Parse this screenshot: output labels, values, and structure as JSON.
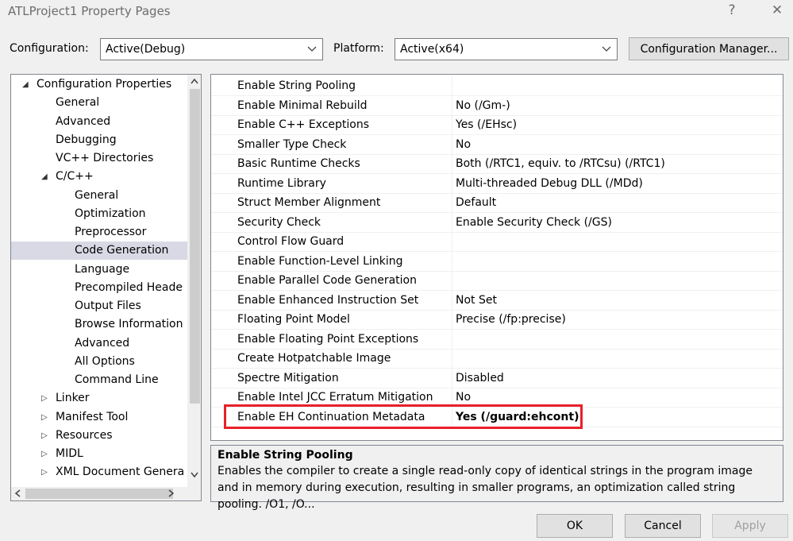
{
  "window": {
    "title": "ATLProject1 Property Pages",
    "help_glyph": "?",
    "close_glyph": "✕"
  },
  "toolbar": {
    "configuration_label": "Configuration:",
    "configuration_value": "Active(Debug)",
    "platform_label": "Platform:",
    "platform_value": "Active(x64)",
    "config_manager_label": "Configuration Manager..."
  },
  "tree": {
    "items": [
      {
        "label": "Configuration Properties",
        "expander": "◢"
      },
      {
        "label": "General"
      },
      {
        "label": "Advanced"
      },
      {
        "label": "Debugging"
      },
      {
        "label": "VC++ Directories"
      },
      {
        "label": "C/C++",
        "expander": "◢"
      },
      {
        "label": "General"
      },
      {
        "label": "Optimization"
      },
      {
        "label": "Preprocessor"
      },
      {
        "label": "Code Generation"
      },
      {
        "label": "Language"
      },
      {
        "label": "Precompiled Heade"
      },
      {
        "label": "Output Files"
      },
      {
        "label": "Browse Information"
      },
      {
        "label": "Advanced"
      },
      {
        "label": "All Options"
      },
      {
        "label": "Command Line"
      },
      {
        "label": "Linker",
        "expander": "▷"
      },
      {
        "label": "Manifest Tool",
        "expander": "▷"
      },
      {
        "label": "Resources",
        "expander": "▷"
      },
      {
        "label": "MIDL",
        "expander": "▷"
      },
      {
        "label": "XML Document Genera",
        "expander": "▷"
      }
    ],
    "selected": "Code Generation"
  },
  "properties": [
    {
      "name": "Enable String Pooling",
      "value": ""
    },
    {
      "name": "Enable Minimal Rebuild",
      "value": "No (/Gm-)"
    },
    {
      "name": "Enable C++ Exceptions",
      "value": "Yes (/EHsc)"
    },
    {
      "name": "Smaller Type Check",
      "value": "No"
    },
    {
      "name": "Basic Runtime Checks",
      "value": "Both (/RTC1, equiv. to /RTCsu) (/RTC1)"
    },
    {
      "name": "Runtime Library",
      "value": "Multi-threaded Debug DLL (/MDd)"
    },
    {
      "name": "Struct Member Alignment",
      "value": "Default"
    },
    {
      "name": "Security Check",
      "value": "Enable Security Check (/GS)"
    },
    {
      "name": "Control Flow Guard",
      "value": ""
    },
    {
      "name": "Enable Function-Level Linking",
      "value": ""
    },
    {
      "name": "Enable Parallel Code Generation",
      "value": ""
    },
    {
      "name": "Enable Enhanced Instruction Set",
      "value": "Not Set"
    },
    {
      "name": "Floating Point Model",
      "value": "Precise (/fp:precise)"
    },
    {
      "name": "Enable Floating Point Exceptions",
      "value": ""
    },
    {
      "name": "Create Hotpatchable Image",
      "value": ""
    },
    {
      "name": "Spectre Mitigation",
      "value": "Disabled"
    },
    {
      "name": "Enable Intel JCC Erratum Mitigation",
      "value": "No"
    },
    {
      "name": "Enable EH Continuation Metadata",
      "value": "Yes (/guard:ehcont)"
    }
  ],
  "description": {
    "title": "Enable String Pooling",
    "text": "Enables the compiler to create a single read-only copy of identical strings in the program image and in memory during execution, resulting in smaller programs, an optimization called string pooling. /O1, /O..."
  },
  "buttons": {
    "ok": "OK",
    "cancel": "Cancel",
    "apply": "Apply"
  },
  "colors": {
    "highlight_border": "#e8202a",
    "selected_bg": "#d9d9e6"
  }
}
